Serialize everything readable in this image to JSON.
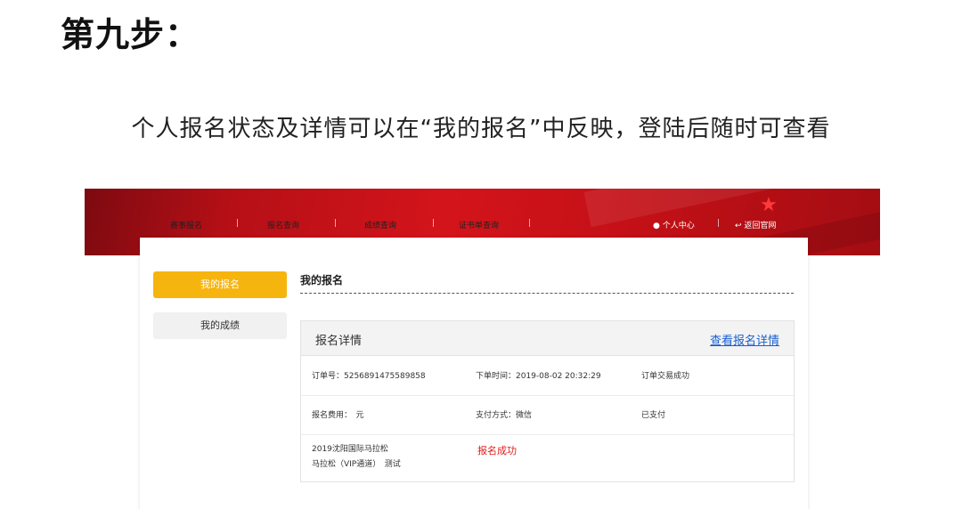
{
  "step_title": "第九步：",
  "subtitle": "个人报名状态及详情可以在“我的报名”中反映，登陆后随时可查看",
  "nav": {
    "items": [
      "赛事报名",
      "报名查询",
      "成绩查询",
      "证书单查询"
    ],
    "separator": "|",
    "user_center": "个人中心",
    "back_home": "返回官网"
  },
  "sidebar": {
    "items": [
      {
        "label": "我的报名",
        "active": true
      },
      {
        "label": "我的成绩",
        "active": false
      }
    ]
  },
  "main": {
    "title": "我的报名",
    "detail": {
      "heading": "报名详情",
      "view_link": "查看报名详情",
      "rows": [
        {
          "order_no": "订单号：5256891475589858",
          "order_time": "下单时间：2019-08-02 20:32:29",
          "order_status": "订单交易成功"
        },
        {
          "fee": "报名费用：　元",
          "pay_method": "支付方式：微信",
          "pay_status": "已支付"
        },
        {
          "event_line1": "2019沈阳国际马拉松",
          "event_line2": "马拉松（VIP通道）　测试",
          "result": "报名成功"
        }
      ]
    }
  },
  "colors": {
    "banner_red": "#d4141b",
    "active_tab": "#f6b40e",
    "link_blue": "#1a5fd0",
    "success_red": "#e01c1c"
  }
}
